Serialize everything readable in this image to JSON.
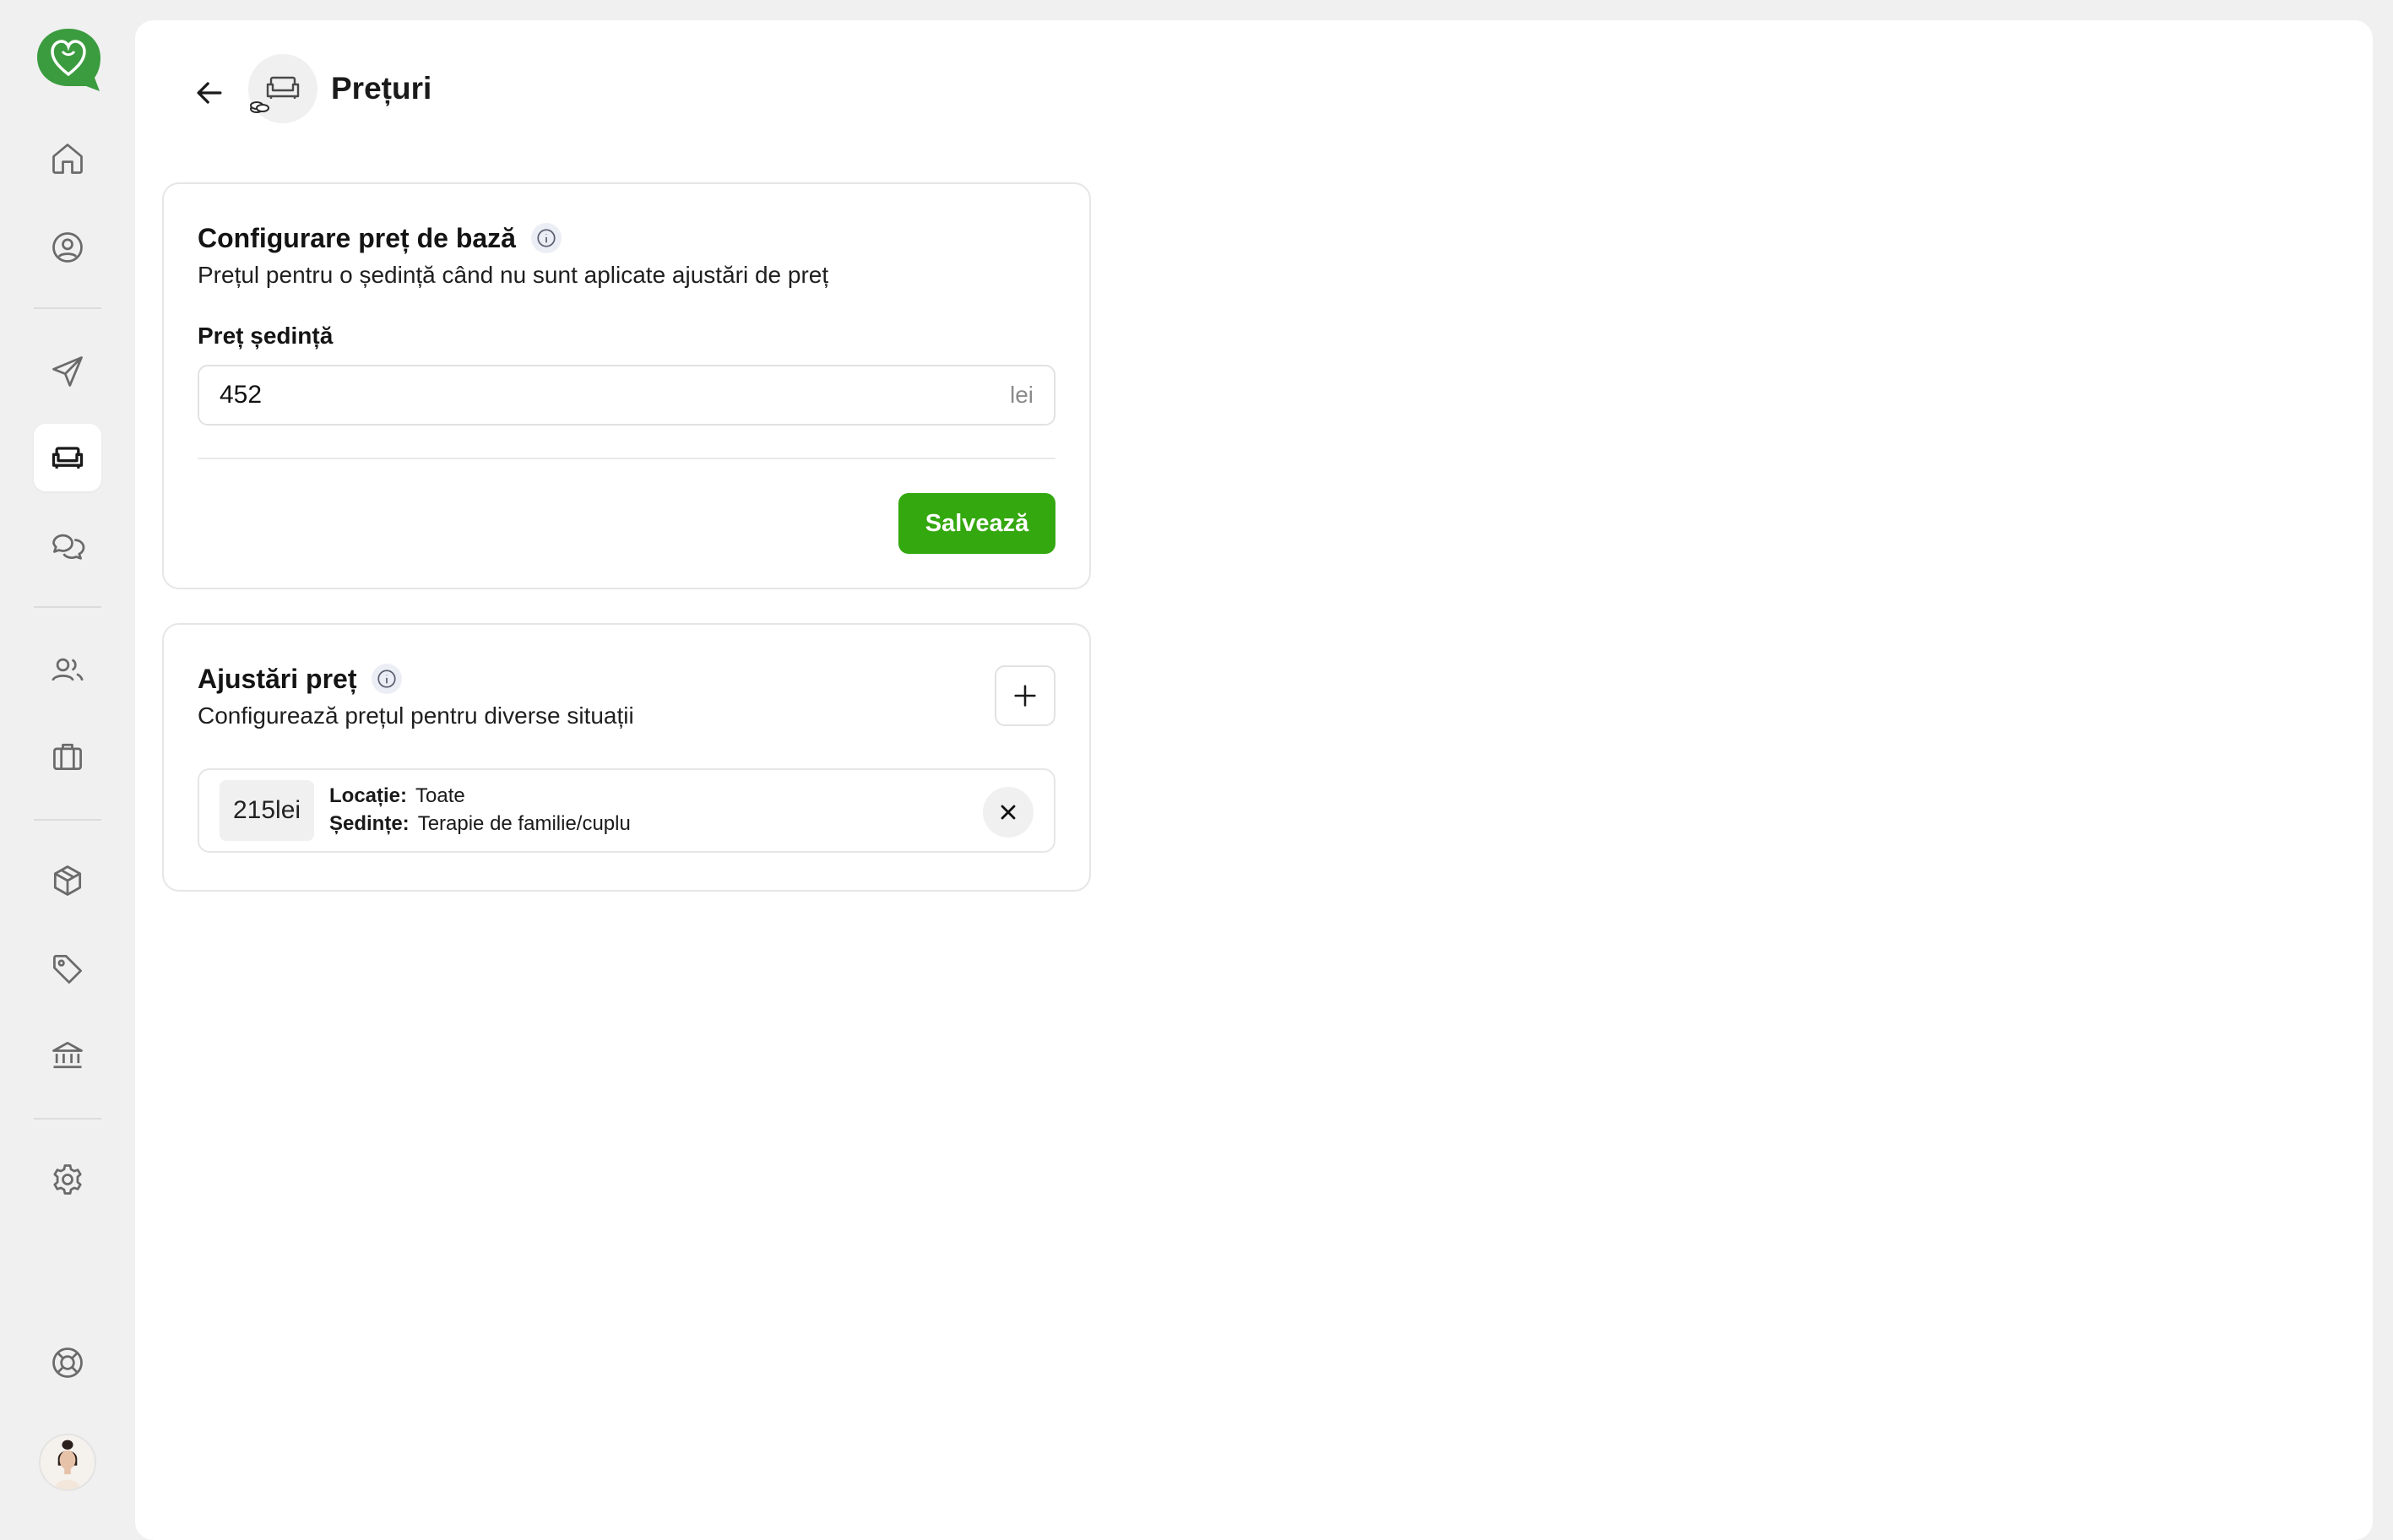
{
  "sidebar": {
    "items": [
      {
        "name": "home-icon"
      },
      {
        "name": "user-circle-icon"
      },
      {
        "name": "send-icon"
      },
      {
        "name": "sofa-icon",
        "active": true
      },
      {
        "name": "chat-icon"
      },
      {
        "name": "users-icon"
      },
      {
        "name": "briefcase-icon"
      },
      {
        "name": "box-icon"
      },
      {
        "name": "tag-icon"
      },
      {
        "name": "bank-icon"
      },
      {
        "name": "gear-icon"
      },
      {
        "name": "lifebuoy-icon"
      }
    ]
  },
  "header": {
    "title": "Prețuri"
  },
  "base_price": {
    "title": "Configurare preț de bază",
    "subtitle": "Prețul pentru o ședință când nu sunt aplicate ajustări de preț",
    "field_label": "Preț ședință",
    "value": "452",
    "suffix": "lei",
    "save_label": "Salvează"
  },
  "adjustments": {
    "title": "Ajustări preț",
    "subtitle": "Configurează prețul pentru diverse situații",
    "items": [
      {
        "price": "215lei",
        "location_label": "Locație:",
        "location_value": "Toate",
        "sessions_label": "Ședințe:",
        "sessions_value": "Terapie de familie/cuplu"
      }
    ]
  },
  "colors": {
    "accent": "#34a80f",
    "brand": "#3b9b3f",
    "background": "#f0f0f0"
  }
}
